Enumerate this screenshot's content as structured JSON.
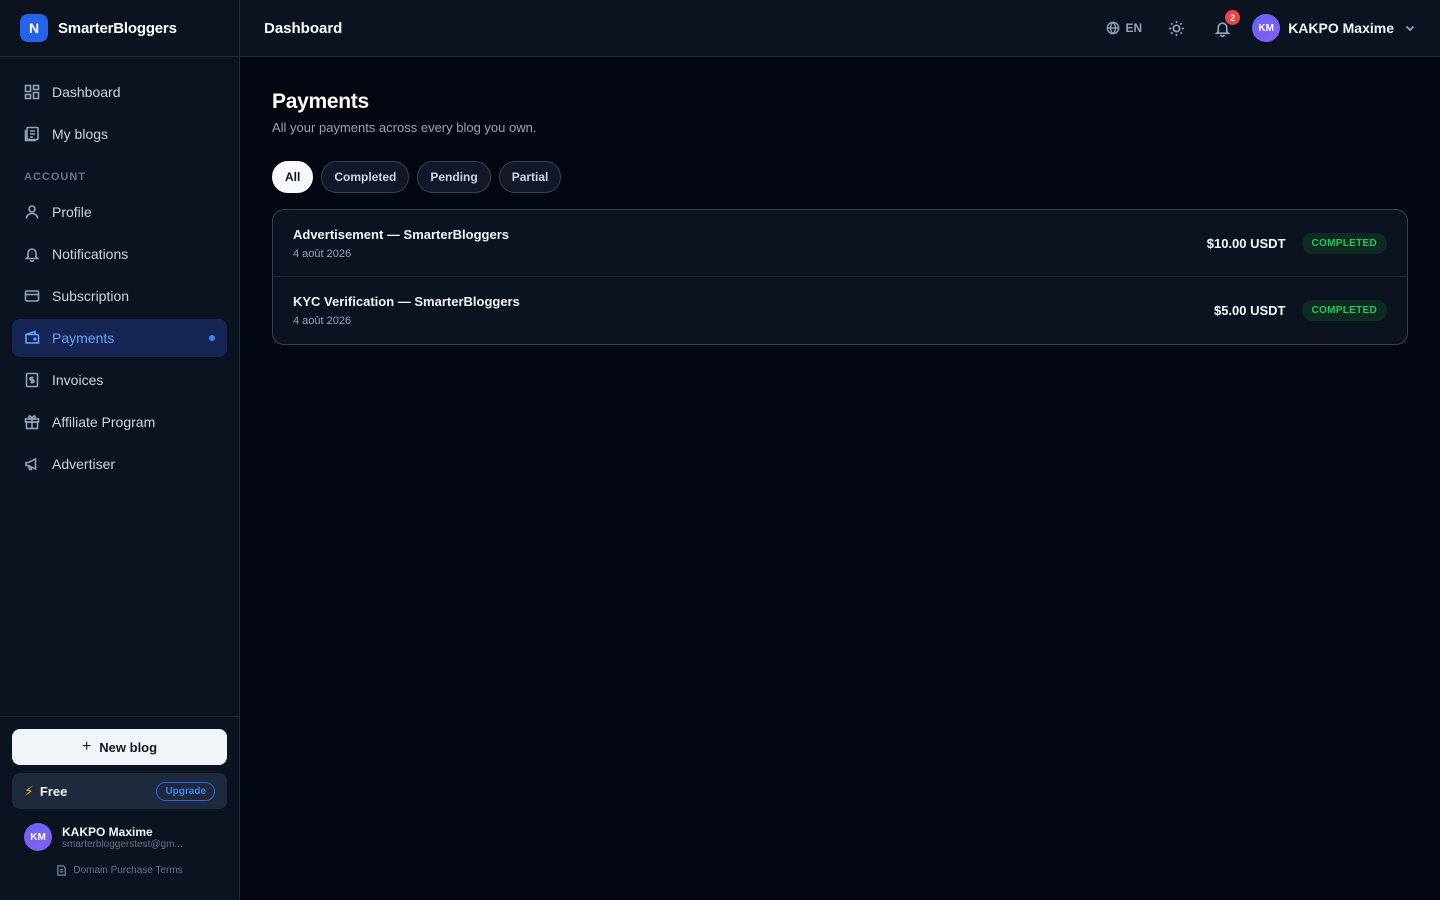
{
  "brand": {
    "logo_letter": "N",
    "name": "SmarterBloggers"
  },
  "sidebar": {
    "items": [
      {
        "label": "Dashboard",
        "icon": "dashboard-icon"
      },
      {
        "label": "My blogs",
        "icon": "blogs-icon"
      }
    ],
    "section_label": "ACCOUNT",
    "account_items": [
      {
        "label": "Profile",
        "icon": "user-icon"
      },
      {
        "label": "Notifications",
        "icon": "bell-icon"
      },
      {
        "label": "Subscription",
        "icon": "card-icon"
      },
      {
        "label": "Payments",
        "icon": "wallet-icon",
        "active": true
      },
      {
        "label": "Invoices",
        "icon": "invoice-icon"
      },
      {
        "label": "Affiliate Program",
        "icon": "gift-icon"
      },
      {
        "label": "Advertiser",
        "icon": "megaphone-icon"
      }
    ],
    "new_blog_label": "New blog",
    "plan_label": "Free",
    "upgrade_label": "Upgrade",
    "user": {
      "initials": "KM",
      "name": "KAKPO Maxime",
      "email": "smarterbloggerstest@gm..."
    },
    "terms_label": "Domain Purchase Terms"
  },
  "header": {
    "title": "Dashboard",
    "lang": "EN",
    "notification_count": "2",
    "user_initials": "KM",
    "user_name": "KAKPO Maxime"
  },
  "main": {
    "title": "Payments",
    "subtitle": "All your payments across every blog you own.",
    "filters": [
      "All",
      "Completed",
      "Pending",
      "Partial"
    ],
    "active_filter": "All",
    "payments": [
      {
        "title": "Advertisement — SmarterBloggers",
        "date": "4 août 2026",
        "amount": "$10.00 USDT",
        "status": "COMPLETED"
      },
      {
        "title": "KYC Verification — SmarterBloggers",
        "date": "4 août 2026",
        "amount": "$5.00 USDT",
        "status": "COMPLETED"
      }
    ]
  },
  "colors": {
    "accent": "#3b82f6",
    "success": "#22c55e",
    "danger": "#ef4444",
    "background": "#030712"
  }
}
